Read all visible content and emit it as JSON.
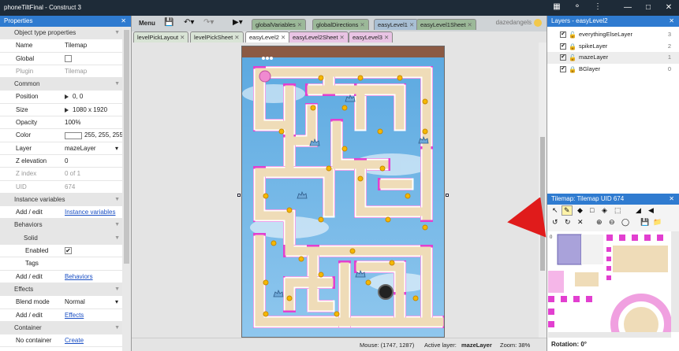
{
  "window": {
    "title": "phoneTiltFinal - Construct 3",
    "controls": [
      "—",
      "□",
      "✕"
    ],
    "top_icons": [
      "clipboard-icon",
      "key-icon",
      "more-icon"
    ]
  },
  "properties": {
    "header": "Properties",
    "close": "✕",
    "rows": [
      {
        "type": "section",
        "label": "Object type properties"
      },
      {
        "type": "row",
        "label": "Name",
        "value": "Tilemap"
      },
      {
        "type": "row",
        "label": "Global",
        "value": "",
        "control": "checkbox",
        "checked": false
      },
      {
        "type": "row",
        "label": "Plugin",
        "value": "Tilemap",
        "muted": true
      },
      {
        "type": "section",
        "label": "Common"
      },
      {
        "type": "row",
        "label": "Position",
        "value": "0, 0",
        "control": "expand"
      },
      {
        "type": "row",
        "label": "Size",
        "value": "1080 x 1920",
        "control": "expand"
      },
      {
        "type": "row",
        "label": "Opacity",
        "value": "100%"
      },
      {
        "type": "row",
        "label": "Color",
        "value": "255, 255, 255",
        "control": "swatch"
      },
      {
        "type": "row",
        "label": "Layer",
        "value": "mazeLayer",
        "control": "dropdown"
      },
      {
        "type": "row",
        "label": "Z elevation",
        "value": "0"
      },
      {
        "type": "row",
        "label": "Z index",
        "value": "0 of 1",
        "muted": true
      },
      {
        "type": "row",
        "label": "UID",
        "value": "674",
        "muted": true
      },
      {
        "type": "section",
        "label": "Instance variables"
      },
      {
        "type": "row",
        "label": "Add / edit",
        "value": "Instance variables",
        "control": "link"
      },
      {
        "type": "section",
        "label": "Behaviors"
      },
      {
        "type": "section",
        "label": "Solid",
        "indent": true
      },
      {
        "type": "row",
        "label": "Enabled",
        "value": "",
        "control": "checkbox",
        "checked": true,
        "indent": true
      },
      {
        "type": "row",
        "label": "Tags",
        "value": "",
        "indent": true
      },
      {
        "type": "row",
        "label": "Add / edit",
        "value": "Behaviors",
        "control": "link"
      },
      {
        "type": "section",
        "label": "Effects"
      },
      {
        "type": "row",
        "label": "Blend mode",
        "value": "Normal",
        "control": "dropdown"
      },
      {
        "type": "row",
        "label": "Add / edit",
        "value": "Effects",
        "control": "link"
      },
      {
        "type": "section",
        "label": "Container"
      },
      {
        "type": "row",
        "label": "No container",
        "value": "Create",
        "control": "link"
      }
    ]
  },
  "toolbar": {
    "menu": "Menu",
    "user": "dazedangels"
  },
  "tabs_row1": [
    {
      "label": "globalVariables",
      "style": "green"
    },
    {
      "label": "globalDirections",
      "style": "green"
    },
    {
      "label": "easyLevel1",
      "style": "blue"
    },
    {
      "label": "easyLevel1Sheet",
      "style": "green"
    }
  ],
  "tabs_row2": [
    {
      "label": "levelPickLayout",
      "style": "light"
    },
    {
      "label": "levelPickSheet",
      "style": "light"
    },
    {
      "label": "easyLevel2",
      "style": "white"
    },
    {
      "label": "easyLevel2Sheet",
      "style": "pink"
    },
    {
      "label": "easyLevel3",
      "style": "pink"
    }
  ],
  "status": {
    "mouse": "Mouse: (1747, 1287)",
    "layer_label": "Active layer:",
    "layer": "mazeLayer",
    "zoom": "Zoom: 38%"
  },
  "layers": {
    "header": "Layers - easyLevel2",
    "close": "✕",
    "items": [
      {
        "name": "everythingElseLayer",
        "num": "3",
        "locked": false
      },
      {
        "name": "spikeLayer",
        "num": "2",
        "locked": true
      },
      {
        "name": "mazeLayer",
        "num": "1",
        "locked": false,
        "selected": true
      },
      {
        "name": "BGlayer",
        "num": "0",
        "locked": true
      }
    ]
  },
  "tilemap": {
    "header": "Tilemap: Tilemap UID 674",
    "close": "✕",
    "rotation": "Rotation: 0°",
    "tile_index": "0"
  },
  "colors": {
    "accent": "#2f7bd0",
    "titlebar": "#1e2b38",
    "arrow": "#e01b1b",
    "maze_path": "#efdcb8",
    "maze_border": "#e23fd0",
    "sky": "#6ab2e6"
  }
}
